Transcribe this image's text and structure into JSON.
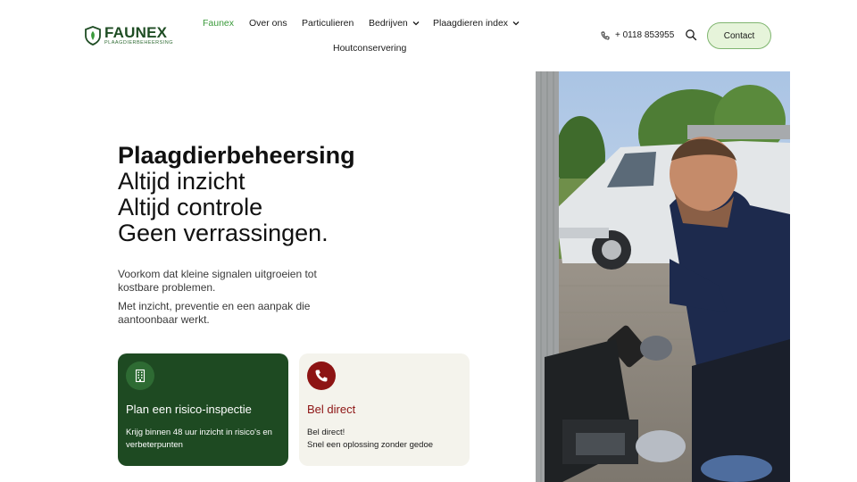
{
  "brand": {
    "name": "FAUNEX",
    "tagline": "PLAAGDIERBEHEERSING",
    "primary_color": "#1e4a22",
    "accent_color": "#3a9a3a",
    "alert_color": "#8d1414"
  },
  "nav": {
    "items": [
      {
        "label": "Faunex",
        "active": true
      },
      {
        "label": "Over ons"
      },
      {
        "label": "Particulieren"
      },
      {
        "label": "Bedrijven",
        "dropdown": true
      },
      {
        "label": "Plaagdieren index",
        "dropdown": true
      },
      {
        "label": "Houtconservering"
      }
    ],
    "phone": "+ 0118 853955",
    "contact_label": "Contact"
  },
  "hero": {
    "title_strong": "Plaagdierbeheersing",
    "lines": [
      "Altijd inzicht",
      "Altijd controle",
      "Geen verrassingen."
    ],
    "p1": "Voorkom dat kleine signalen uitgroeien tot kostbare problemen.",
    "p2": "Met inzicht, preventie en een aanpak die aantoonbaar werkt."
  },
  "cards": [
    {
      "icon": "building-icon",
      "title": "Plan een risico-inspectie",
      "desc": "Krijg binnen 48 uur inzicht in risico's en verbeterpunten"
    },
    {
      "icon": "phone-icon",
      "title": "Bel direct",
      "desc_lines": [
        "Bel direct!",
        "Snel een oplossing zonder gedoe"
      ]
    }
  ]
}
